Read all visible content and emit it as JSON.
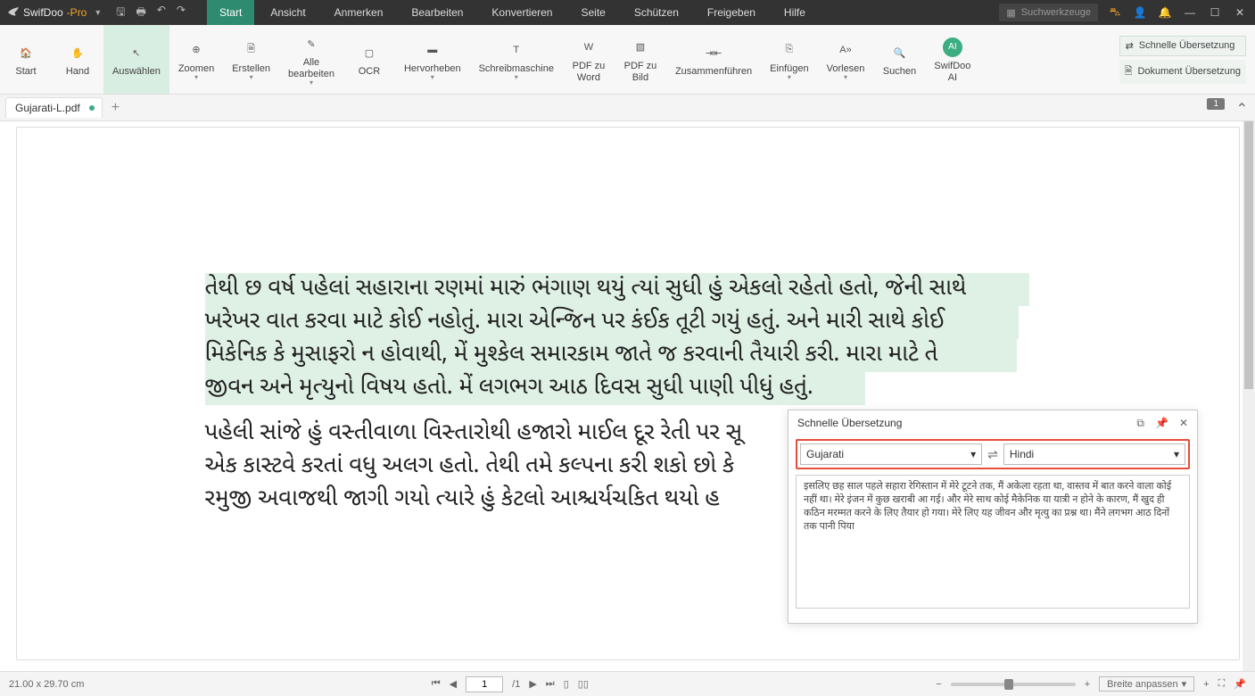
{
  "title": {
    "brand": "SwifDoo",
    "pro": "-Pro"
  },
  "menus": [
    "Start",
    "Ansicht",
    "Anmerken",
    "Bearbeiten",
    "Konvertieren",
    "Seite",
    "Schützen",
    "Freigeben",
    "Hilfe"
  ],
  "search_placeholder": "Suchwerkzeuge",
  "ribbon": [
    {
      "label": "Start"
    },
    {
      "label": "Hand"
    },
    {
      "label": "Auswählen"
    },
    {
      "label": "Zoomen"
    },
    {
      "label": "Erstellen"
    },
    {
      "label": "Alle\nbearbeiten"
    },
    {
      "label": "OCR"
    },
    {
      "label": "Hervorheben"
    },
    {
      "label": "Schreibmaschine"
    },
    {
      "label": "PDF zu\nWord"
    },
    {
      "label": "PDF zu\nBild"
    },
    {
      "label": "Zusammenführen"
    },
    {
      "label": "Einfügen"
    },
    {
      "label": "Vorlesen"
    },
    {
      "label": "Suchen"
    },
    {
      "label": "SwifDoo\nAI"
    }
  ],
  "ribbon_side": {
    "quick": "Schnelle Übersetzung",
    "doc": "Dokument Übersetzung"
  },
  "tab_name": "Gujarati-L.pdf",
  "page_badge": "1",
  "doc": {
    "hl": [
      "તેથી છ વર્ષ પહેલાં સહારાના રણમાં મારું ભંગાણ થયું ત્યાં સુધી હું એકલો રહેતો હતો, જેની સાથે",
      "ખરેખર વાત કરવા માટે કોઈ નહોતું. મારા એન્જિન પર કંઈક તૂટી ગયું હતું. અને મારી સાથે કોઈ",
      "મિકેનિક કે મુસાફરો ન હોવાથી, મેં મુશ્કેલ સમારકામ જાતે જ કરવાની તૈયારી કરી. મારા માટે તે",
      "જીવન અને મૃત્યુનો વિષય હતો. મેં લગભગ આઠ દિવસ સુધી પાણી પીધું હતું."
    ],
    "plain": [
      "પહેલી સાંજે હું વસ્તીવાળા વિસ્તારોથી હજારો માઈલ દૂર રેતી પર સૂ",
      "એક કાસ્ટવે કરતાં વધુ અલગ હતો. તેથી તમે કલ્પના કરી શકો છો કે",
      "રમુજી અવાજથી જાગી ગયો ત્યારે હું કેટલો આશ્ચર્યચકિત થયો હ"
    ]
  },
  "panel": {
    "title": "Schnelle Übersetzung",
    "src": "Gujarati",
    "dst": "Hindi",
    "out": "इसलिए छह साल पहले सहारा रेगिस्तान में मेरे टूटने तक, मैं अकेला रहता था, वास्तव में बात करने वाला कोई नहीं था। मेरे इंजन में कुछ खराबी आ गई। और मेरे साथ कोई मैकेनिक या यात्री न होने के कारण, मैं खुद ही कठिन मरम्मत करने के लिए तैयार हो गया। मेरे लिए यह जीवन और मृत्यु का प्रश्न था। मैंने लगभग आठ दिनों तक पानी पिया"
  },
  "status": {
    "dim": "21.00 x 29.70 cm",
    "page": "1",
    "total": "/1",
    "fit": "Breite anpassen"
  }
}
